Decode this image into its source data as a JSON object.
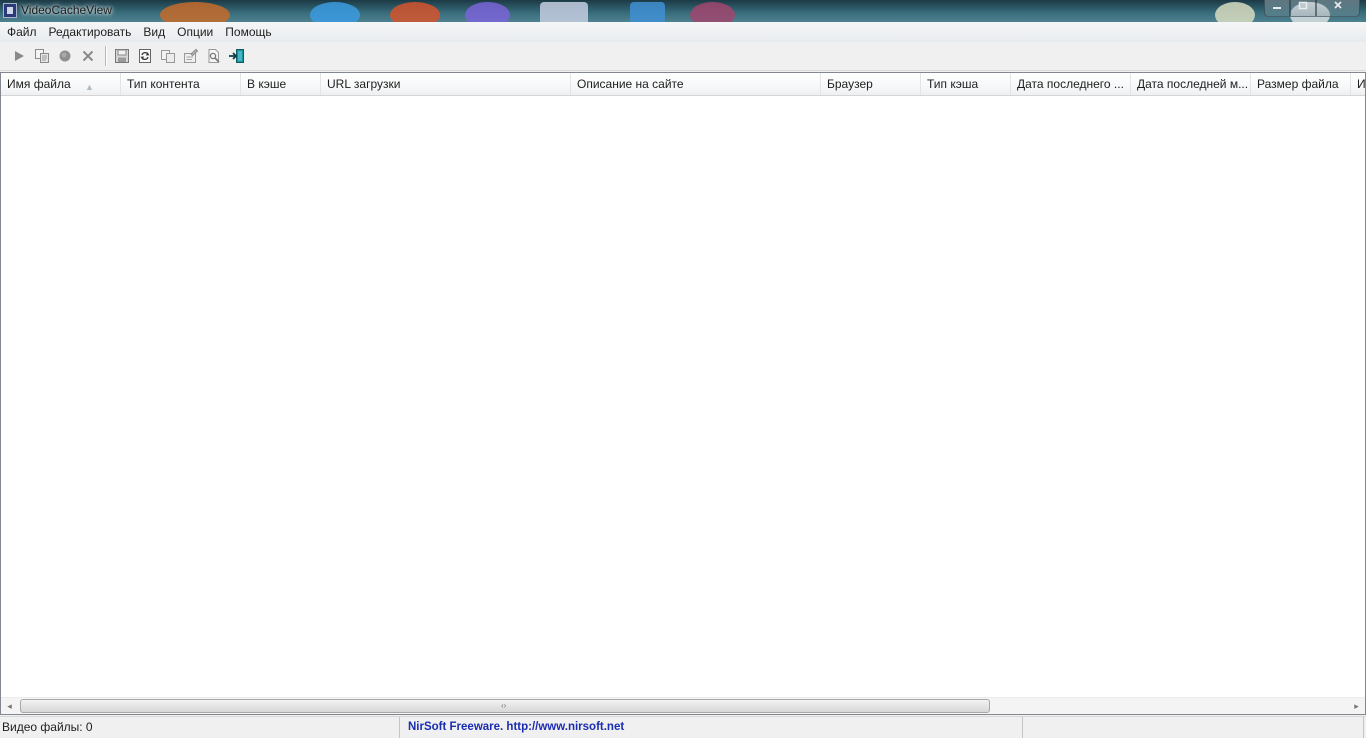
{
  "window": {
    "title": "VideoCacheView",
    "app_icon": "app-icon",
    "controls": [
      "minimize-icon",
      "maximize-icon",
      "close-icon"
    ]
  },
  "menu": {
    "items": [
      "Файл",
      "Редактировать",
      "Вид",
      "Опции",
      "Помощь"
    ]
  },
  "toolbar": {
    "icons": [
      "play-icon",
      "copy-files-icon",
      "stop-icon",
      "delete-icon",
      "save-icon",
      "refresh-icon",
      "copy-icon",
      "properties-icon",
      "find-icon",
      "exit-icon"
    ]
  },
  "list": {
    "columns": [
      "Имя файла",
      "Тип контента",
      "В кэше",
      "URL загрузки",
      "Описание на сайте",
      "Браузер",
      "Тип кэша",
      "Дата последнего ...",
      "Дата последней м...",
      "Размер файла",
      "И"
    ],
    "sort_indicator": "▲",
    "rows": []
  },
  "scrollbar": {
    "left_arrow": "◂",
    "right_arrow": "▸",
    "grip": "‹›"
  },
  "status": {
    "count": "Видео файлы: 0",
    "credits": "NirSoft Freeware.  http://www.nirsoft.net"
  },
  "colors": {
    "credits_text": "#1a2cb0",
    "play": "#8a8a8a",
    "exit_icon": "#1b8f9c"
  }
}
